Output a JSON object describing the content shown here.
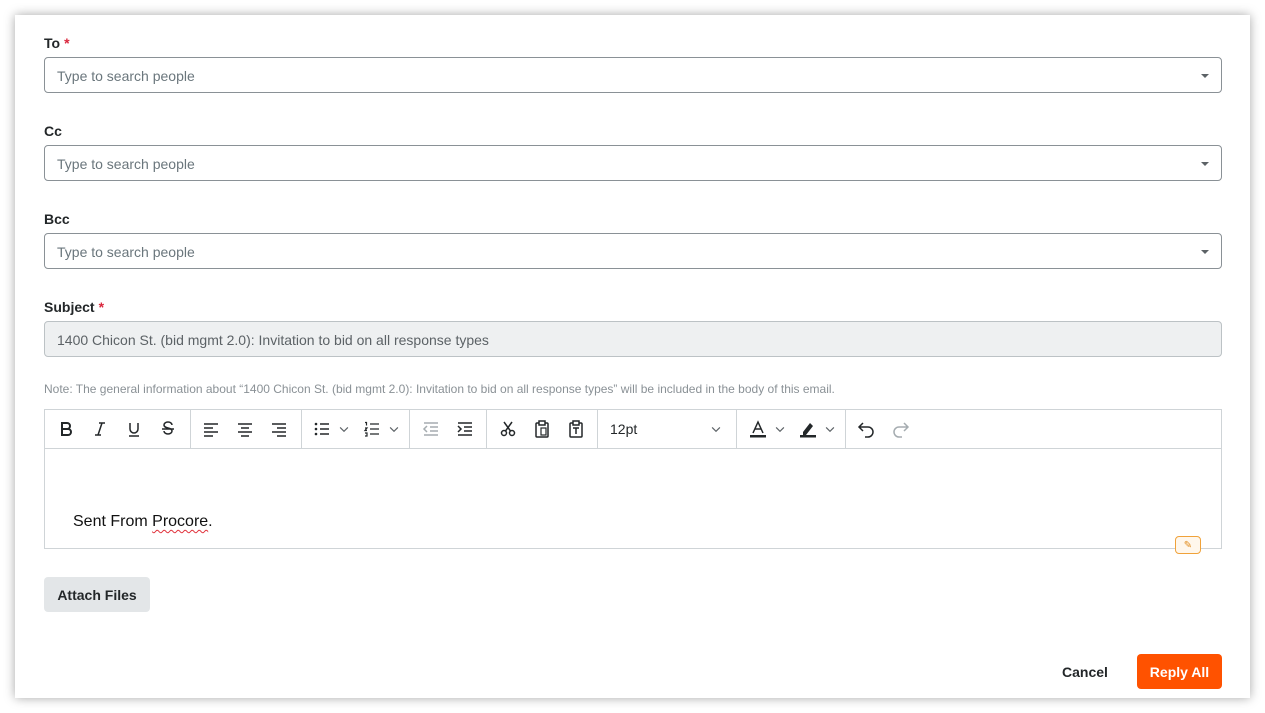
{
  "form": {
    "to": {
      "label": "To",
      "required_mark": "*",
      "placeholder": "Type to search people"
    },
    "cc": {
      "label": "Cc",
      "placeholder": "Type to search people"
    },
    "bcc": {
      "label": "Bcc",
      "placeholder": "Type to search people"
    },
    "subject": {
      "label": "Subject",
      "required_mark": "*",
      "value": "1400 Chicon St. (bid mgmt 2.0): Invitation to bid on all response types"
    },
    "note": "Note: The general information about “1400 Chicon St. (bid mgmt 2.0): Invitation to bid on all response types” will be included in the body of this email."
  },
  "editor": {
    "font_size": "12pt",
    "body_prefix": "Sent From ",
    "body_misspelled": "Procore",
    "body_suffix": ".",
    "toolbar_icons": [
      "bold-icon",
      "italic-icon",
      "underline-icon",
      "strikethrough-icon",
      "align-left-icon",
      "align-center-icon",
      "align-right-icon",
      "bullet-list-icon",
      "numbered-list-icon",
      "outdent-icon",
      "indent-icon",
      "cut-icon",
      "paste-icon",
      "paste-text-icon",
      "text-color-icon",
      "highlight-icon",
      "undo-icon",
      "redo-icon"
    ]
  },
  "actions": {
    "attach_files": "Attach Files",
    "cancel": "Cancel",
    "reply_all": "Reply All"
  },
  "colors": {
    "primary": "#ff5200",
    "required": "#d9263c",
    "spellcheck": "#e0303a"
  }
}
